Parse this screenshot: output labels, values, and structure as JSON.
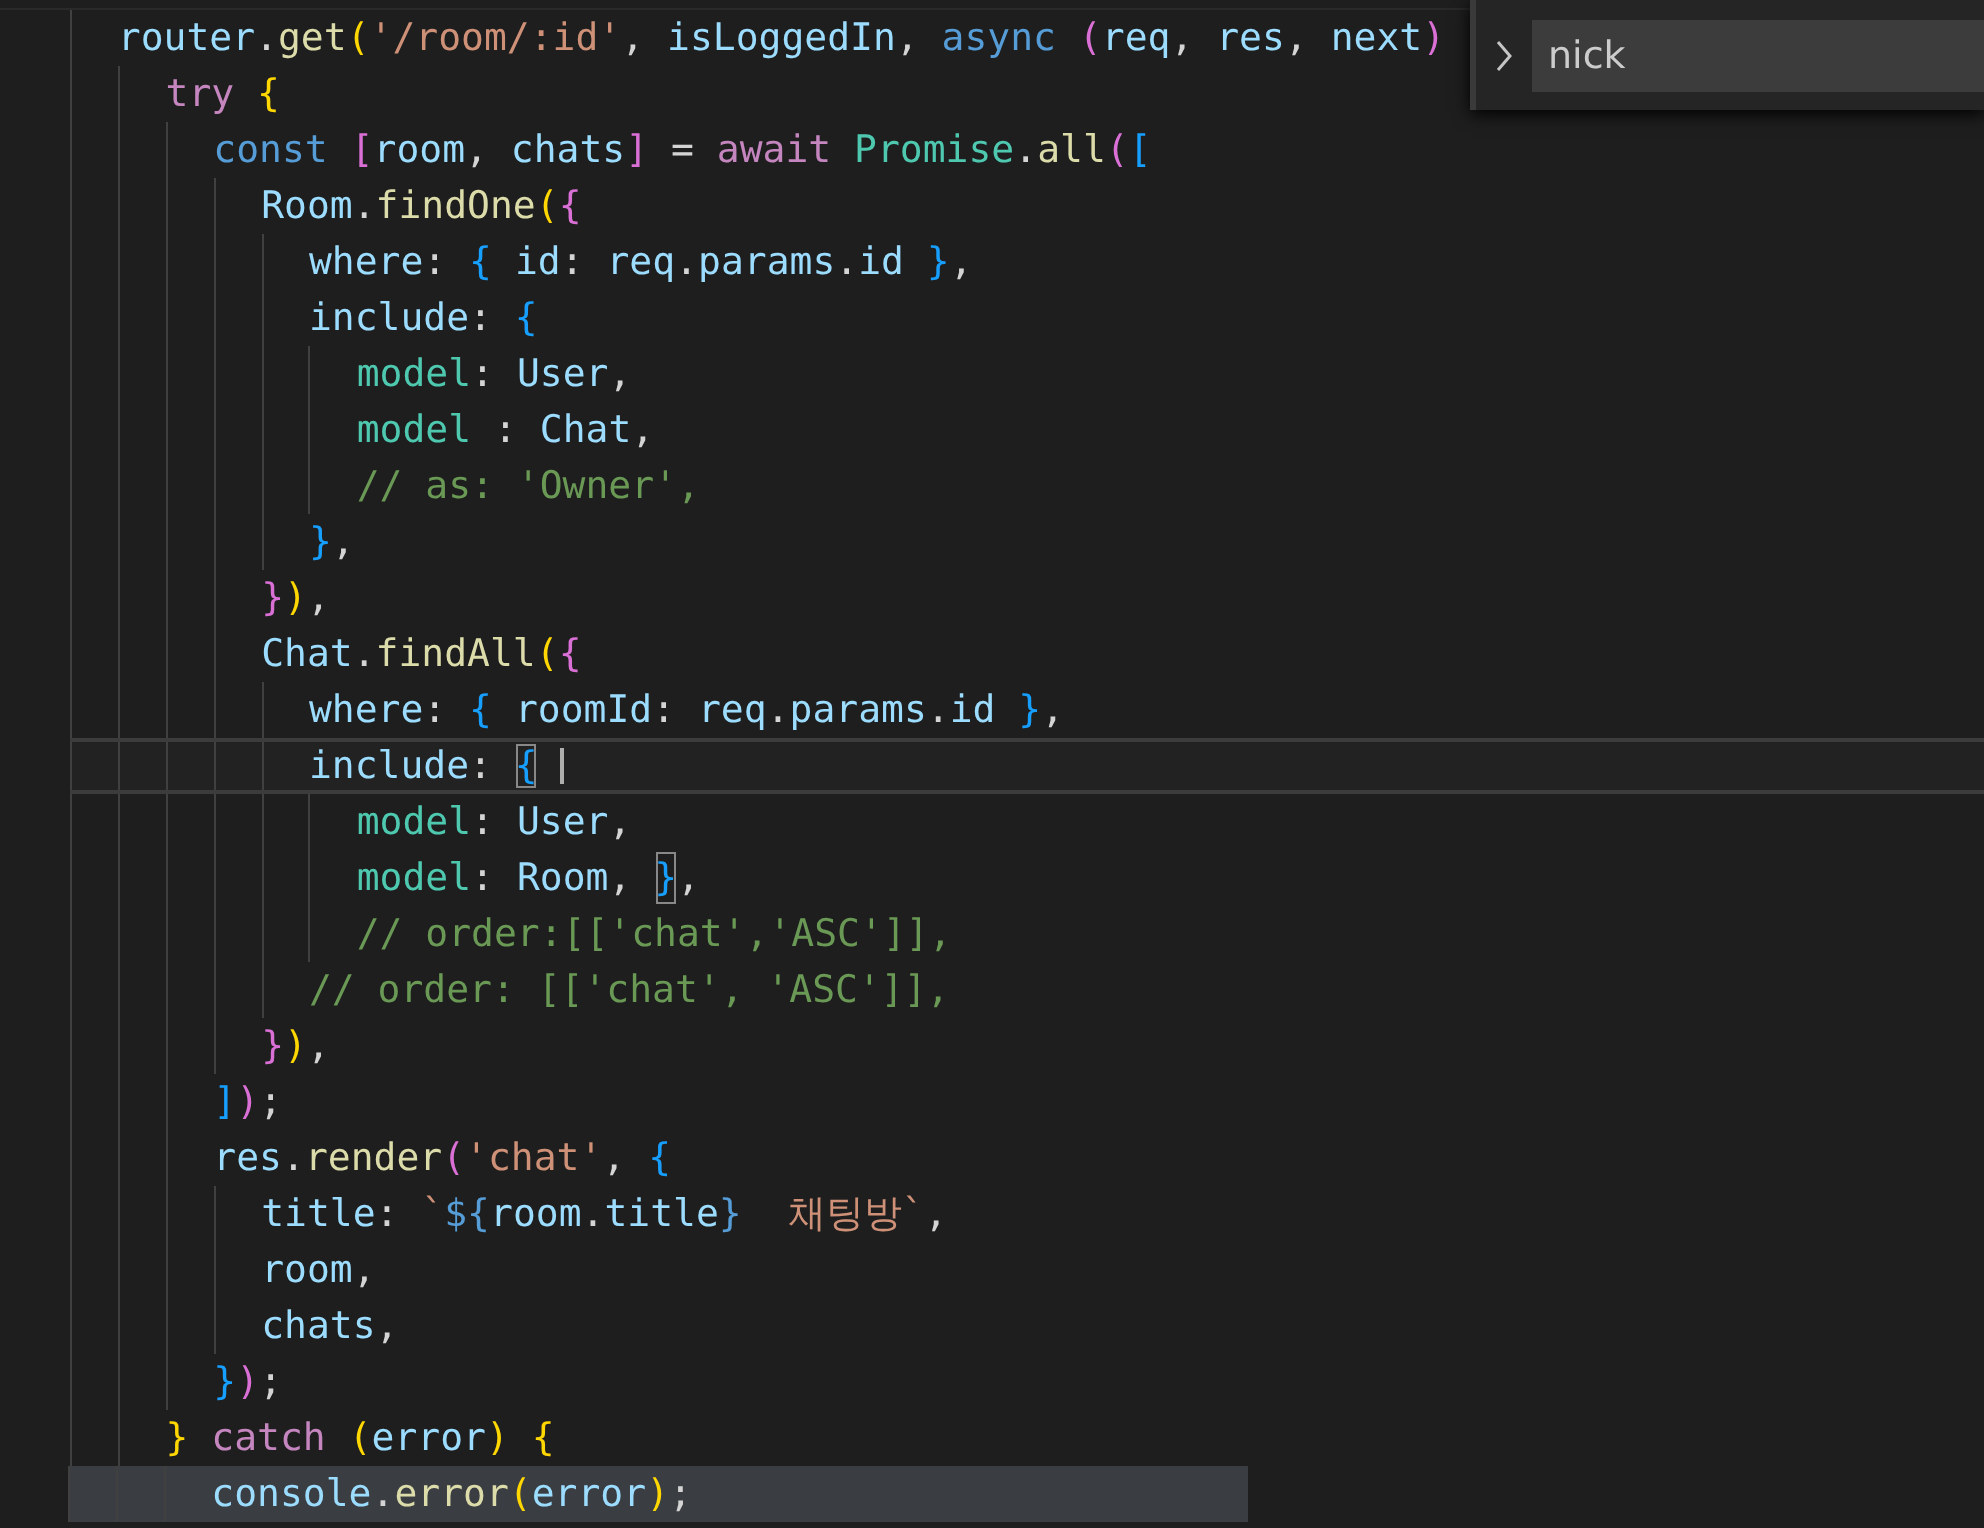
{
  "editor": {
    "lines": [
      {
        "current": false,
        "selected": false,
        "tokens": [
          {
            "text": "  router",
            "kind": "var"
          },
          {
            "text": ".",
            "kind": "p"
          },
          {
            "text": "get",
            "kind": "fn"
          },
          {
            "text": "(",
            "kind": "b1"
          },
          {
            "text": "'/room/:id'",
            "kind": "str"
          },
          {
            "text": ", ",
            "kind": "p"
          },
          {
            "text": "isLoggedIn",
            "kind": "var"
          },
          {
            "text": ", ",
            "kind": "p"
          },
          {
            "text": "async ",
            "kind": "decl"
          },
          {
            "text": "(",
            "kind": "b2"
          },
          {
            "text": "req",
            "kind": "var"
          },
          {
            "text": ", ",
            "kind": "p"
          },
          {
            "text": "res",
            "kind": "var"
          },
          {
            "text": ", ",
            "kind": "p"
          },
          {
            "text": "next",
            "kind": "var"
          },
          {
            "text": ")",
            "kind": "b2"
          }
        ]
      },
      {
        "current": false,
        "selected": false,
        "tokens": [
          {
            "text": "    try ",
            "kind": "kw"
          },
          {
            "text": "{",
            "kind": "b1"
          }
        ]
      },
      {
        "current": false,
        "selected": false,
        "tokens": [
          {
            "text": "      const ",
            "kind": "decl"
          },
          {
            "text": "[",
            "kind": "b2"
          },
          {
            "text": "room",
            "kind": "var"
          },
          {
            "text": ", ",
            "kind": "p"
          },
          {
            "text": "chats",
            "kind": "var"
          },
          {
            "text": "]",
            "kind": "b2"
          },
          {
            "text": " = ",
            "kind": "p"
          },
          {
            "text": "await ",
            "kind": "kw"
          },
          {
            "text": "Promise",
            "kind": "type"
          },
          {
            "text": ".",
            "kind": "p"
          },
          {
            "text": "all",
            "kind": "fn"
          },
          {
            "text": "(",
            "kind": "b2"
          },
          {
            "text": "[",
            "kind": "b3"
          }
        ]
      },
      {
        "current": false,
        "selected": false,
        "tokens": [
          {
            "text": "        Room",
            "kind": "var"
          },
          {
            "text": ".",
            "kind": "p"
          },
          {
            "text": "findOne",
            "kind": "fn"
          },
          {
            "text": "(",
            "kind": "b1"
          },
          {
            "text": "{",
            "kind": "b2"
          }
        ]
      },
      {
        "current": false,
        "selected": false,
        "tokens": [
          {
            "text": "          where",
            "kind": "var"
          },
          {
            "text": ": ",
            "kind": "p"
          },
          {
            "text": "{ ",
            "kind": "b3"
          },
          {
            "text": "id",
            "kind": "var"
          },
          {
            "text": ": ",
            "kind": "p"
          },
          {
            "text": "req",
            "kind": "var"
          },
          {
            "text": ".",
            "kind": "p"
          },
          {
            "text": "params",
            "kind": "var"
          },
          {
            "text": ".",
            "kind": "p"
          },
          {
            "text": "id ",
            "kind": "var"
          },
          {
            "text": "}",
            "kind": "b3"
          },
          {
            "text": ",",
            "kind": "p"
          }
        ]
      },
      {
        "current": false,
        "selected": false,
        "tokens": [
          {
            "text": "          include",
            "kind": "var"
          },
          {
            "text": ": ",
            "kind": "p"
          },
          {
            "text": "{",
            "kind": "b3"
          }
        ]
      },
      {
        "current": false,
        "selected": false,
        "tokens": [
          {
            "text": "            model",
            "kind": "type"
          },
          {
            "text": ": ",
            "kind": "p"
          },
          {
            "text": "User",
            "kind": "var"
          },
          {
            "text": ",",
            "kind": "p"
          }
        ]
      },
      {
        "current": false,
        "selected": false,
        "tokens": [
          {
            "text": "            model",
            "kind": "type"
          },
          {
            "text": " : ",
            "kind": "p"
          },
          {
            "text": "Chat",
            "kind": "var"
          },
          {
            "text": ",",
            "kind": "p"
          }
        ]
      },
      {
        "current": false,
        "selected": false,
        "tokens": [
          {
            "text": "            // as: 'Owner',",
            "kind": "com"
          }
        ]
      },
      {
        "current": false,
        "selected": false,
        "tokens": [
          {
            "text": "          }",
            "kind": "b3"
          },
          {
            "text": ",",
            "kind": "p"
          }
        ]
      },
      {
        "current": false,
        "selected": false,
        "tokens": [
          {
            "text": "        }",
            "kind": "b2"
          },
          {
            "text": ")",
            "kind": "b1"
          },
          {
            "text": ",",
            "kind": "p"
          }
        ]
      },
      {
        "current": false,
        "selected": false,
        "tokens": [
          {
            "text": "        Chat",
            "kind": "var"
          },
          {
            "text": ".",
            "kind": "p"
          },
          {
            "text": "findAll",
            "kind": "fn"
          },
          {
            "text": "(",
            "kind": "b1"
          },
          {
            "text": "{",
            "kind": "b2"
          }
        ]
      },
      {
        "current": false,
        "selected": false,
        "tokens": [
          {
            "text": "          where",
            "kind": "var"
          },
          {
            "text": ": ",
            "kind": "p"
          },
          {
            "text": "{ ",
            "kind": "b3"
          },
          {
            "text": "roomId",
            "kind": "var"
          },
          {
            "text": ": ",
            "kind": "p"
          },
          {
            "text": "req",
            "kind": "var"
          },
          {
            "text": ".",
            "kind": "p"
          },
          {
            "text": "params",
            "kind": "var"
          },
          {
            "text": ".",
            "kind": "p"
          },
          {
            "text": "id ",
            "kind": "var"
          },
          {
            "text": "}",
            "kind": "b3"
          },
          {
            "text": ",",
            "kind": "p"
          }
        ]
      },
      {
        "current": true,
        "selected": false,
        "tokens": [
          {
            "text": "          include",
            "kind": "var"
          },
          {
            "text": ": ",
            "kind": "p"
          },
          {
            "text": "{",
            "kind": "match"
          }
        ]
      },
      {
        "current": false,
        "selected": false,
        "tokens": [
          {
            "text": "            model",
            "kind": "type"
          },
          {
            "text": ": ",
            "kind": "p"
          },
          {
            "text": "User",
            "kind": "var"
          },
          {
            "text": ",",
            "kind": "p"
          }
        ]
      },
      {
        "current": false,
        "selected": false,
        "tokens": [
          {
            "text": "            model",
            "kind": "type"
          },
          {
            "text": ": ",
            "kind": "p"
          },
          {
            "text": "Room",
            "kind": "var"
          },
          {
            "text": ", ",
            "kind": "p"
          },
          {
            "text": "}",
            "kind": "match"
          },
          {
            "text": ",",
            "kind": "p"
          }
        ]
      },
      {
        "current": false,
        "selected": false,
        "tokens": [
          {
            "text": "            // order:[['chat','ASC']],",
            "kind": "com"
          }
        ]
      },
      {
        "current": false,
        "selected": false,
        "tokens": [
          {
            "text": "          // order: [['chat', 'ASC']],",
            "kind": "com"
          }
        ]
      },
      {
        "current": false,
        "selected": false,
        "tokens": [
          {
            "text": "        }",
            "kind": "b2"
          },
          {
            "text": ")",
            "kind": "b1"
          },
          {
            "text": ",",
            "kind": "p"
          }
        ]
      },
      {
        "current": false,
        "selected": false,
        "tokens": [
          {
            "text": "      ]",
            "kind": "b3"
          },
          {
            "text": ")",
            "kind": "b2"
          },
          {
            "text": ";",
            "kind": "p"
          }
        ]
      },
      {
        "current": false,
        "selected": false,
        "tokens": [
          {
            "text": "      res",
            "kind": "var"
          },
          {
            "text": ".",
            "kind": "p"
          },
          {
            "text": "render",
            "kind": "fn"
          },
          {
            "text": "(",
            "kind": "b2"
          },
          {
            "text": "'chat'",
            "kind": "str"
          },
          {
            "text": ", ",
            "kind": "p"
          },
          {
            "text": "{",
            "kind": "b3"
          }
        ]
      },
      {
        "current": false,
        "selected": false,
        "tokens": [
          {
            "text": "        title",
            "kind": "var"
          },
          {
            "text": ": ",
            "kind": "p"
          },
          {
            "text": "`",
            "kind": "str"
          },
          {
            "text": "${",
            "kind": "decl"
          },
          {
            "text": "room",
            "kind": "var"
          },
          {
            "text": ".",
            "kind": "p"
          },
          {
            "text": "title",
            "kind": "var"
          },
          {
            "text": "}",
            "kind": "decl"
          },
          {
            "text": "  채팅방`",
            "kind": "str"
          },
          {
            "text": ",",
            "kind": "p"
          }
        ]
      },
      {
        "current": false,
        "selected": false,
        "tokens": [
          {
            "text": "        room",
            "kind": "var"
          },
          {
            "text": ",",
            "kind": "p"
          }
        ]
      },
      {
        "current": false,
        "selected": false,
        "tokens": [
          {
            "text": "        chats",
            "kind": "var"
          },
          {
            "text": ",",
            "kind": "p"
          }
        ]
      },
      {
        "current": false,
        "selected": false,
        "tokens": [
          {
            "text": "      }",
            "kind": "b3"
          },
          {
            "text": ")",
            "kind": "b2"
          },
          {
            "text": ";",
            "kind": "p"
          }
        ]
      },
      {
        "current": false,
        "selected": false,
        "tokens": [
          {
            "text": "    } ",
            "kind": "b1"
          },
          {
            "text": "catch ",
            "kind": "kw"
          },
          {
            "text": "(",
            "kind": "b1"
          },
          {
            "text": "error",
            "kind": "var"
          },
          {
            "text": ") ",
            "kind": "b1"
          },
          {
            "text": "{",
            "kind": "b1"
          }
        ]
      },
      {
        "current": false,
        "selected": true,
        "tokens": [
          {
            "text": "      console",
            "kind": "var"
          },
          {
            "text": ".",
            "kind": "p"
          },
          {
            "text": "error",
            "kind": "fn"
          },
          {
            "text": "(",
            "kind": "b1"
          },
          {
            "text": "error",
            "kind": "var"
          },
          {
            "text": ")",
            "kind": "b1"
          },
          {
            "text": ";",
            "kind": "p"
          }
        ]
      }
    ]
  },
  "find_widget": {
    "expanded": false,
    "query": "nick"
  }
}
